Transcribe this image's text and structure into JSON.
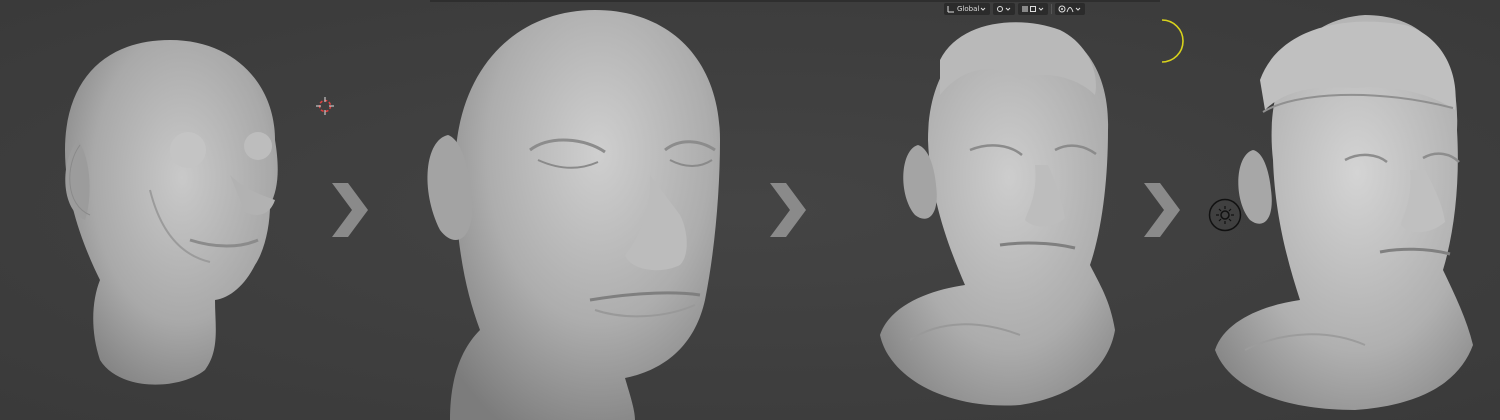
{
  "viewport": {
    "transform_orientation": "Global"
  },
  "colors": {
    "background": "#3d3d3d",
    "clay": "#b7b7b7",
    "arrow": "#8a8a8a",
    "sun_arc": "#d8d21c"
  },
  "stages": [
    {
      "name": "stage-1-blockout"
    },
    {
      "name": "stage-2-refined"
    },
    {
      "name": "stage-3-detailed"
    },
    {
      "name": "stage-4-final"
    }
  ],
  "icons": [
    "3d-cursor-icon",
    "chevron-right-icon",
    "light-icon",
    "sun-arc-icon",
    "snap-icon",
    "proportional-edit-icon"
  ]
}
